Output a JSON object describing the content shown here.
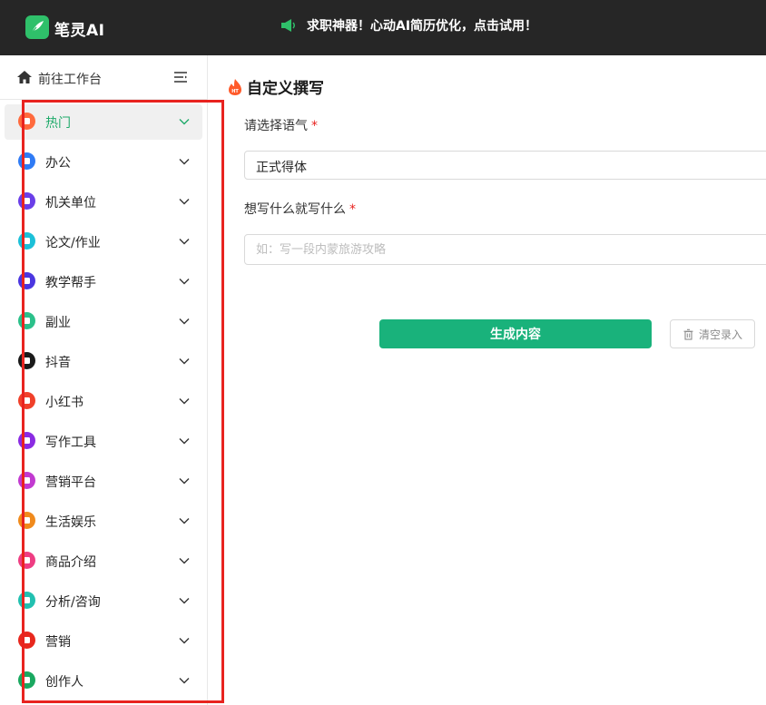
{
  "header": {
    "brand": "笔灵AI",
    "announcement": "求职神器！心动AI简历优化，点击试用！"
  },
  "sidebar": {
    "workbench_label": "前往工作台",
    "items": [
      {
        "label": "热门",
        "color": "#ff6a3d",
        "icon": "hot-icon"
      },
      {
        "label": "办公",
        "color": "#2f7bf5",
        "icon": "office-icon"
      },
      {
        "label": "机关单位",
        "color": "#6a3ee8",
        "icon": "institution-icon"
      },
      {
        "label": "论文/作业",
        "color": "#1cc0d8",
        "icon": "paper-icon"
      },
      {
        "label": "教学帮手",
        "color": "#4b36e0",
        "icon": "teaching-icon"
      },
      {
        "label": "副业",
        "color": "#2bc08a",
        "icon": "sideline-icon"
      },
      {
        "label": "抖音",
        "color": "#1a1a1a",
        "icon": "douyin-icon"
      },
      {
        "label": "小红书",
        "color": "#f0402a",
        "icon": "xiaohongshu-icon"
      },
      {
        "label": "写作工具",
        "color": "#8a2be2",
        "icon": "writing-tool-icon"
      },
      {
        "label": "营销平台",
        "color": "#c13ad0",
        "icon": "marketing-platform-icon"
      },
      {
        "label": "生活娱乐",
        "color": "#f08a1c",
        "icon": "life-icon"
      },
      {
        "label": "商品介绍",
        "color": "#ee3d82",
        "icon": "product-icon"
      },
      {
        "label": "分析/咨询",
        "color": "#22c0b0",
        "icon": "analysis-icon"
      },
      {
        "label": "营销",
        "color": "#e8281e",
        "icon": "marketing-icon"
      },
      {
        "label": "创作人",
        "color": "#1aa860",
        "icon": "creator-icon"
      }
    ],
    "active_color": "#1faa6a"
  },
  "main": {
    "title": "自定义撰写",
    "tone_label": "请选择语气",
    "required_mark": "*",
    "tone_value": "正式得体",
    "content_label": "想写什么就写什么",
    "content_placeholder": "如：写一段内蒙旅游攻略",
    "generate_label": "生成内容",
    "clear_label": "清空录入"
  }
}
